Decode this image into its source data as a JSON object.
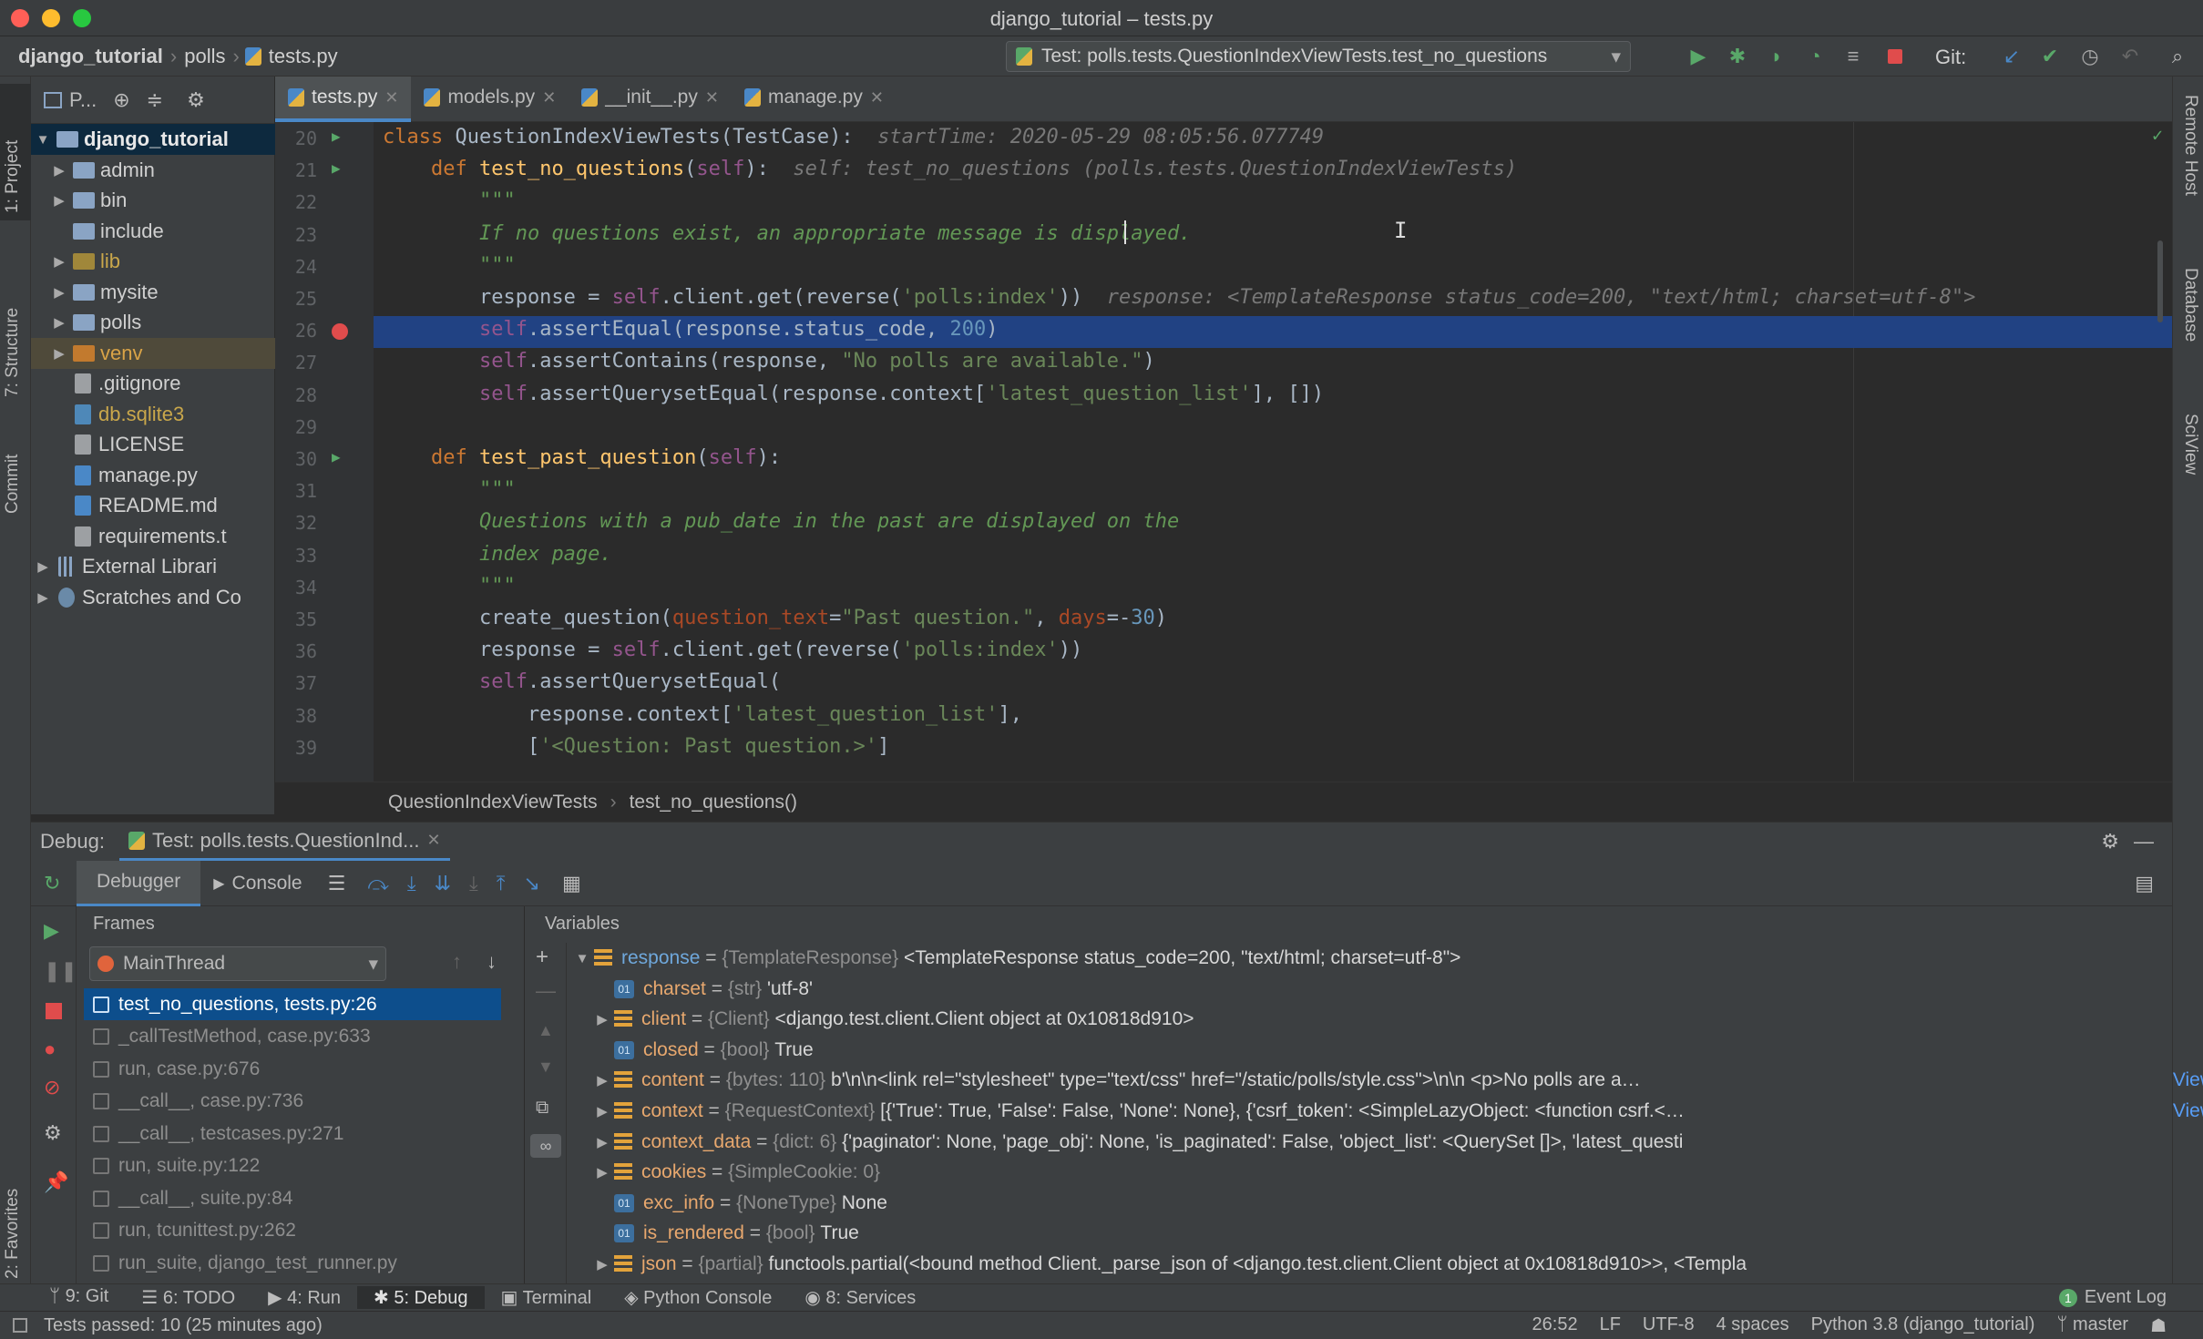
{
  "window": {
    "title": "django_tutorial – tests.py"
  },
  "navbar": {
    "crumbs": [
      "django_tutorial",
      "polls",
      "tests.py"
    ],
    "run_config": "Test: polls.tests.QuestionIndexViewTests.test_no_questions",
    "git_label": "Git:"
  },
  "left_tools": [
    "1: Project",
    "7: Structure",
    "Commit",
    "2: Favorites"
  ],
  "right_tools": [
    "Remote Host",
    "Database",
    "SciView"
  ],
  "project": {
    "header": "P...",
    "tree": [
      {
        "label": "django_tutorial",
        "kind": "root",
        "depth": 0,
        "expanded": true,
        "selected": true
      },
      {
        "label": "admin",
        "kind": "folder",
        "depth": 1,
        "expandable": true
      },
      {
        "label": "bin",
        "kind": "folder",
        "depth": 1,
        "expandable": true
      },
      {
        "label": "include",
        "kind": "folder",
        "depth": 1,
        "expandable": false
      },
      {
        "label": "lib",
        "kind": "folder-excluded",
        "depth": 1,
        "expandable": true
      },
      {
        "label": "mysite",
        "kind": "folder",
        "depth": 1,
        "expandable": true
      },
      {
        "label": "polls",
        "kind": "folder",
        "depth": 1,
        "expandable": true
      },
      {
        "label": "venv",
        "kind": "folder-venv",
        "depth": 1,
        "expandable": true
      },
      {
        "label": ".gitignore",
        "kind": "file",
        "depth": 1
      },
      {
        "label": "db.sqlite3",
        "kind": "db",
        "depth": 1
      },
      {
        "label": "LICENSE",
        "kind": "text",
        "depth": 1
      },
      {
        "label": "manage.py",
        "kind": "py",
        "depth": 1
      },
      {
        "label": "README.md",
        "kind": "md",
        "depth": 1
      },
      {
        "label": "requirements.t",
        "kind": "text",
        "depth": 1
      },
      {
        "label": "External Librari",
        "kind": "lib",
        "depth": 0,
        "expandable": true
      },
      {
        "label": "Scratches and Co",
        "kind": "scratch",
        "depth": 0,
        "expandable": true
      }
    ]
  },
  "tabs": [
    {
      "label": "tests.py",
      "active": true
    },
    {
      "label": "models.py",
      "active": false
    },
    {
      "label": "__init__.py",
      "active": false
    },
    {
      "label": "manage.py",
      "active": false
    }
  ],
  "editor": {
    "lines": [
      {
        "n": "20",
        "html": "<span class=\"kw\">class </span>QuestionIndexViewTests(TestCase):  <span class=\"hint\">startTime: 2020-05-29 08:05:56.077749</span>"
      },
      {
        "n": "21",
        "html": "    <span class=\"kw\">def </span><span class=\"fn\">test_no_questions</span>(<span class=\"self\">self</span>):  <span class=\"hint\">self: test_no_questions (polls.tests.QuestionIndexViewTests)</span>"
      },
      {
        "n": "22",
        "html": "        <span class=\"doc\">\"\"\"</span>"
      },
      {
        "n": "23",
        "html": "        <span class=\"doc\">If no questions exist, an appropriate message is displayed.</span>"
      },
      {
        "n": "24",
        "html": "        <span class=\"doc\">\"\"\"</span>"
      },
      {
        "n": "25",
        "html": "        response = <span class=\"self\">self</span>.client.get(reverse(<span class=\"str\">'polls:index'</span>))  <span class=\"hint\">response: &lt;TemplateResponse status_code=200, \"text/html; charset=utf-8\"&gt;</span>"
      },
      {
        "n": "26",
        "html": "        <span class=\"self\">self</span>.assertEqual(response.status_code, <span class=\"num\">200</span>)"
      },
      {
        "n": "27",
        "html": "        <span class=\"self\">self</span>.assertContains(response, <span class=\"str\">\"No polls are available.\"</span>)"
      },
      {
        "n": "28",
        "html": "        <span class=\"self\">self</span>.assertQuerysetEqual(response.context[<span class=\"str\">'latest_question_list'</span>], [])"
      },
      {
        "n": "29",
        "html": ""
      },
      {
        "n": "30",
        "html": "    <span class=\"kw\">def </span><span class=\"fn\">test_past_question</span>(<span class=\"self\">self</span>):"
      },
      {
        "n": "31",
        "html": "        <span class=\"doc\">\"\"\"</span>"
      },
      {
        "n": "32",
        "html": "        <span class=\"doc\">Questions with a pub_date in the past are displayed on the</span>"
      },
      {
        "n": "33",
        "html": "        <span class=\"doc\">index page.</span>"
      },
      {
        "n": "34",
        "html": "        <span class=\"doc\">\"\"\"</span>"
      },
      {
        "n": "35",
        "html": "        create_question(<span class=\"param\">question_text</span>=<span class=\"str\">\"Past question.\"</span>, <span class=\"param\">days</span>=-<span class=\"num\">30</span>)"
      },
      {
        "n": "36",
        "html": "        response = <span class=\"self\">self</span>.client.get(reverse(<span class=\"str\">'polls:index'</span>))"
      },
      {
        "n": "37",
        "html": "        <span class=\"self\">self</span>.assertQuerysetEqual("
      },
      {
        "n": "38",
        "html": "            response.context[<span class=\"str\">'latest_question_list'</span>],"
      },
      {
        "n": "39",
        "html": "            [<span class=\"str\">'&lt;Question: Past question.&gt;'</span>]"
      }
    ],
    "current_line": "26",
    "breakpoint_line": "26",
    "run_markers": [
      "20",
      "21",
      "30"
    ],
    "breadcrumb": [
      "QuestionIndexViewTests",
      "test_no_questions()"
    ]
  },
  "debug": {
    "label": "Debug:",
    "session": "Test: polls.tests.QuestionInd...",
    "tabs": [
      "Debugger",
      "Console"
    ],
    "frames_title": "Frames",
    "variables_title": "Variables",
    "thread": "MainThread",
    "frames": [
      {
        "label": "test_no_questions, tests.py:26",
        "selected": true
      },
      {
        "label": "_callTestMethod, case.py:633"
      },
      {
        "label": "run, case.py:676"
      },
      {
        "label": "__call__, case.py:736"
      },
      {
        "label": "__call__, testcases.py:271"
      },
      {
        "label": "run, suite.py:122"
      },
      {
        "label": "__call__, suite.py:84"
      },
      {
        "label": "run, tcunittest.py:262"
      },
      {
        "label": "run_suite, django_test_runner.py"
      }
    ],
    "variables": [
      {
        "name": "response",
        "type": "{TemplateResponse}",
        "value": "<TemplateResponse status_code=200, \"text/html; charset=utf-8\">",
        "icon": "field",
        "expand": "open",
        "indent": 0,
        "top": true
      },
      {
        "name": "charset",
        "type": "{str}",
        "value": "'utf-8'",
        "icon": "object",
        "expand": "none",
        "indent": 1
      },
      {
        "name": "client",
        "type": "{Client}",
        "value": "<django.test.client.Client object at 0x10818d910>",
        "icon": "field",
        "expand": "closed",
        "indent": 1
      },
      {
        "name": "closed",
        "type": "{bool}",
        "value": "True",
        "icon": "object",
        "expand": "none",
        "indent": 1
      },
      {
        "name": "content",
        "type": "{bytes: 110}",
        "value": "b'\\n\\n<link rel=\"stylesheet\" type=\"text/css\" href=\"/static/polls/style.css\">\\n\\n    <p>No polls are a…",
        "icon": "field",
        "expand": "closed",
        "indent": 1,
        "view": "View"
      },
      {
        "name": "context",
        "type": "{RequestContext}",
        "value": "[{'True': True, 'False': False, 'None': None}, {'csrf_token': <SimpleLazyObject: <function csrf.<…",
        "icon": "field",
        "expand": "closed",
        "indent": 1,
        "view": "View"
      },
      {
        "name": "context_data",
        "type": "{dict: 6}",
        "value": "{'paginator': None, 'page_obj': None, 'is_paginated': False, 'object_list': <QuerySet []>, 'latest_questi",
        "icon": "field",
        "expand": "closed",
        "indent": 1
      },
      {
        "name": "cookies",
        "type": "{SimpleCookie: 0}",
        "value": "",
        "icon": "field",
        "expand": "closed",
        "indent": 1
      },
      {
        "name": "exc_info",
        "type": "{NoneType}",
        "value": "None",
        "icon": "object",
        "expand": "none",
        "indent": 1
      },
      {
        "name": "is_rendered",
        "type": "{bool}",
        "value": "True",
        "icon": "object",
        "expand": "none",
        "indent": 1
      },
      {
        "name": "json",
        "type": "{partial}",
        "value": "functools.partial(<bound method Client._parse_json of <django.test.client.Client object at 0x10818d910>>, <Templa",
        "icon": "field",
        "expand": "closed",
        "indent": 1
      }
    ]
  },
  "bottom_tools": [
    {
      "label": "9: Git",
      "icon": "git"
    },
    {
      "label": "6: TODO",
      "icon": "list"
    },
    {
      "label": "4: Run",
      "icon": "play"
    },
    {
      "label": "5: Debug",
      "icon": "bug",
      "active": true
    },
    {
      "label": "Terminal",
      "icon": "terminal"
    },
    {
      "label": "Python Console",
      "icon": "python"
    },
    {
      "label": "8: Services",
      "icon": "services"
    }
  ],
  "event_log": {
    "count": "1",
    "label": "Event Log"
  },
  "status": {
    "message": "Tests passed: 10 (25 minutes ago)",
    "position": "26:52",
    "line_sep": "LF",
    "encoding": "UTF-8",
    "indent": "4 spaces",
    "interpreter": "Python 3.8 (django_tutorial)",
    "branch": "master"
  },
  "colors": {
    "accent": "#4a88c7",
    "selection": "#214283",
    "breakpoint": "#e04c4c",
    "run": "#59a869"
  }
}
